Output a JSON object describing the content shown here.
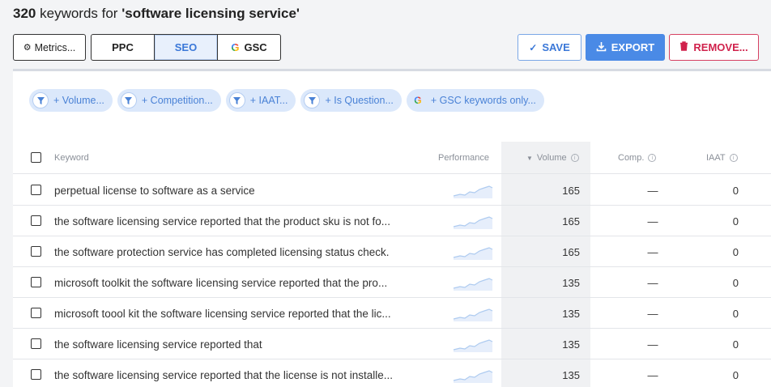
{
  "header": {
    "count": "320",
    "keywords_for": "keywords for",
    "query": "'software licensing service'"
  },
  "toolbar": {
    "metrics_label": "Metrics...",
    "tabs": [
      "PPC",
      "SEO",
      "GSC"
    ],
    "active_tab": "SEO",
    "save_label": "SAVE",
    "export_label": "EXPORT",
    "remove_label": "REMOVE..."
  },
  "filters": [
    {
      "label": "+ Volume...",
      "icon": "filter-icon"
    },
    {
      "label": "+ Competition...",
      "icon": "filter-icon"
    },
    {
      "label": "+ IAAT...",
      "icon": "filter-icon"
    },
    {
      "label": "+ Is Question...",
      "icon": "filter-icon"
    },
    {
      "label": "+ GSC keywords only...",
      "icon": "google-icon"
    }
  ],
  "table": {
    "columns": {
      "keyword": "Keyword",
      "performance": "Performance",
      "volume": "Volume",
      "comp": "Comp.",
      "iaat": "IAAT"
    },
    "sorted_column": "Volume",
    "sort_direction": "descending",
    "rows": [
      {
        "keyword": "perpetual license to software as a service",
        "volume": "165",
        "comp": "—",
        "iaat": "0"
      },
      {
        "keyword": "the software licensing service reported that the product sku is not fo...",
        "volume": "165",
        "comp": "—",
        "iaat": "0"
      },
      {
        "keyword": "the software protection service has completed licensing status check.",
        "volume": "165",
        "comp": "—",
        "iaat": "0"
      },
      {
        "keyword": "microsoft toolkit the software licensing service reported that the pro...",
        "volume": "135",
        "comp": "—",
        "iaat": "0"
      },
      {
        "keyword": "microsoft toool kit the software licensing service reported that the lic...",
        "volume": "135",
        "comp": "—",
        "iaat": "0"
      },
      {
        "keyword": "the software licensing service reported that",
        "volume": "135",
        "comp": "—",
        "iaat": "0"
      },
      {
        "keyword": "the software licensing service reported that the license is not installe...",
        "volume": "135",
        "comp": "—",
        "iaat": "0"
      }
    ]
  },
  "colors": {
    "accent": "#3b78d8",
    "export_bg": "#4a8ae6",
    "remove": "#d0224c",
    "chip_bg": "#dbe8fb",
    "sparkline": "#aecbf0"
  }
}
